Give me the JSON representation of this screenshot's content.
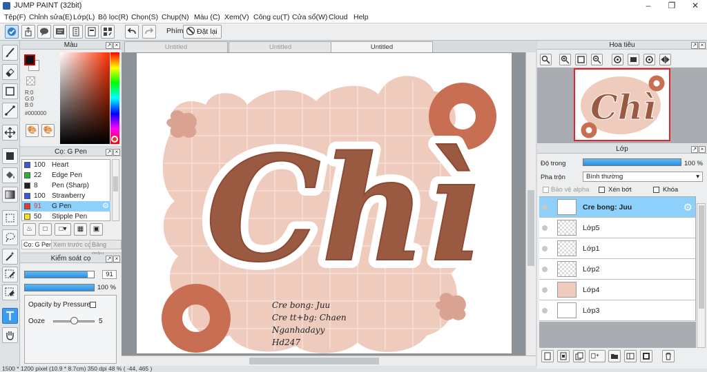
{
  "window": {
    "title": "JUMP PAINT (32bit)"
  },
  "menu": [
    "Tệp(F)",
    "Chỉnh sửa(E)",
    "Lớp(L)",
    "Bộ lọc(R)",
    "Chọn(S)",
    "Chụp(N)",
    "Màu (C)",
    "Xem(V)",
    "Công cụ(T)",
    "Cửa sổ(W)",
    "Cloud",
    "Help"
  ],
  "toolbar": {
    "hotkey_label": "Phím",
    "reset_label": "Đặt lại"
  },
  "color_panel": {
    "title": "Màu",
    "r": "R:0",
    "g": "G:0",
    "b": "B:0",
    "hex": "#000000",
    "fg": "#000000",
    "bg": "#ffffff"
  },
  "brush_panel": {
    "title": "Cọ: G Pen",
    "items": [
      {
        "size": "100",
        "name": "Heart",
        "color": "#3a55e0"
      },
      {
        "size": "22",
        "name": "Edge Pen",
        "color": "#25b536"
      },
      {
        "size": "8",
        "name": "Pen (Sharp)",
        "color": "#222222"
      },
      {
        "size": "100",
        "name": "Strawberry",
        "color": "#3a55e0"
      },
      {
        "size": "91",
        "name": "G Pen",
        "color": "#e63a3a"
      },
      {
        "size": "50",
        "name": "Stipple Pen",
        "color": "#f2e21e"
      }
    ],
    "tabs": [
      "Cọ: G Pen",
      "Xem trước cọ",
      "Bảng màu"
    ]
  },
  "brush_control": {
    "title": "Kiểm soát cọ",
    "size_value": "91",
    "size_fill": 0.91,
    "opacity_value": "100 %",
    "opacity_fill": 1.0,
    "opacity_pressure": "Opacity by Pressure",
    "ooze_label": "Ooze",
    "ooze_value": "5",
    "ooze_fill": 0.5
  },
  "documents": {
    "tabs": [
      "Untitled",
      "Untitled",
      "Untitled"
    ]
  },
  "artwork": {
    "title_text": "Chì",
    "credits": [
      "Cre bong: Juu",
      "Cre tt+bg: Chaen",
      "Nganhadayy",
      "Hd247"
    ]
  },
  "status": {
    "text": "1500 * 1200 pixel   (10.9 * 8.7cm)   350 dpi   48 %   ( -44, 465 )"
  },
  "navigator": {
    "title": "Hoa tiêu"
  },
  "layer_panel": {
    "title": "Lớp",
    "opacity_label": "Độ trong",
    "opacity_value": "100 %",
    "opacity_fill": 1.0,
    "blend_label": "Pha trộn",
    "blend_value": "Bình thường",
    "protect_alpha": "Bảo vệ alpha",
    "clipping": "Xén bớt",
    "lock": "Khóa",
    "layers": [
      {
        "name": "Cre bong: Juu",
        "selected": true
      },
      {
        "name": "Lớp5",
        "selected": false
      },
      {
        "name": "Lớp1",
        "selected": false
      },
      {
        "name": "Lớp2",
        "selected": false
      },
      {
        "name": "Lớp4",
        "selected": false
      },
      {
        "name": "Lớp3",
        "selected": false
      }
    ]
  },
  "colors": {
    "peach": "#efcbbd",
    "rust": "#c86e52",
    "brown": "#8c4a34",
    "accent": "#8cd0fb"
  }
}
